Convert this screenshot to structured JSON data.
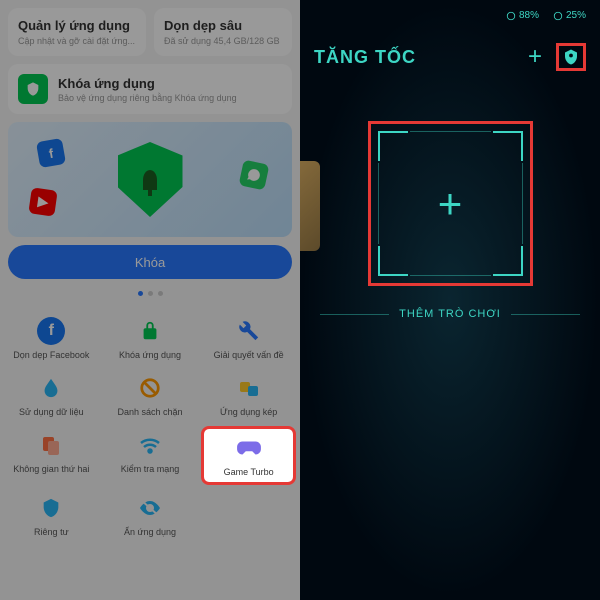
{
  "left": {
    "cards": {
      "manage": {
        "title": "Quản lý ứng dụng",
        "sub": "Cập nhật và gỡ cài đặt ứng..."
      },
      "clean": {
        "title": "Dọn dẹp sâu",
        "sub": "Đã sử dụng 45,4 GB/128 GB"
      }
    },
    "lock": {
      "title": "Khóa ứng dụng",
      "sub": "Bảo vệ ứng dụng riêng bằng Khóa ứng dụng"
    },
    "lock_btn": "Khóa",
    "grid": {
      "facebook": "Dọn dẹp Facebook",
      "lock_app": "Khóa ứng dụng",
      "solve": "Giải quyết vấn đề",
      "data": "Sử dụng dữ liệu",
      "blocklist": "Danh sách chặn",
      "dual": "Ứng dụng kép",
      "second": "Không gian thứ hai",
      "network": "Kiểm tra mạng",
      "gameturbo": "Game Turbo",
      "private": "Riêng tư",
      "hide": "Ẩn ứng dụng"
    }
  },
  "right": {
    "status": {
      "battery": "88%",
      "signal": "25%"
    },
    "title": "TĂNG TỐC",
    "add_game": "THÊM TRÒ CHƠI"
  }
}
